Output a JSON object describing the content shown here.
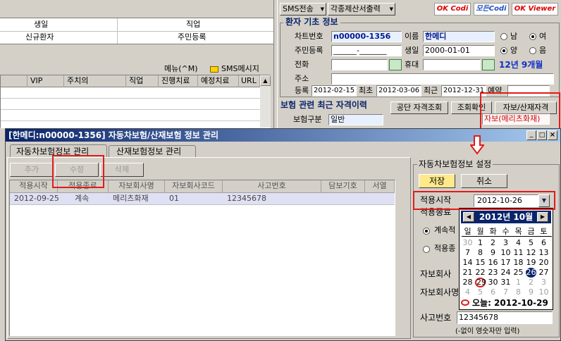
{
  "left_top": {
    "row1": {
      "c1": "생일",
      "c2": "직업"
    },
    "row2": {
      "c1": "신규환자",
      "c2": "주민등록"
    }
  },
  "left_grid": {
    "menu_label": "메뉴(^M)",
    "sms_label": "SMS메시지",
    "columns": [
      "VIP",
      "주치의",
      "직업",
      "진행치료",
      "예정치료",
      "URL"
    ]
  },
  "top_toolbar": {
    "sms_send": "SMS전송",
    "forms_print": "각종제산서출력",
    "logo1": "OK Codi",
    "logo2": "모든Codi",
    "logo3": "OK Viewer"
  },
  "patient": {
    "section_title": "환자 기초 정보",
    "chart_no_label": "차트번호",
    "chart_no": "n00000-1356",
    "name_label": "이름",
    "name": "한메디",
    "gender_male": "남",
    "gender_female": "여",
    "rrn_label": "주민등록",
    "rrn": "______-_______",
    "birth_label": "생일",
    "birth": "2000-01-01",
    "cal_solar": "양",
    "cal_lunar": "음",
    "phone_label": "전화",
    "mobile_label": "휴대",
    "age": "12년 9개월",
    "address_label": "주소",
    "reg_label": "등록",
    "reg_date": "2012-02-15",
    "first_label": "최초",
    "first_date": "2012-03-06",
    "last_label": "최근",
    "last_date": "2012-12-31",
    "extra_label": "예약"
  },
  "insurance": {
    "section_title": "보험 관련 최근 자격이력",
    "btn_check": "공단 자격조회",
    "btn_verify": "조회확인",
    "btn_auto": "자보/산재자격",
    "type_label": "보험구분",
    "type_value": "일반",
    "auto_value": "자보(메리츠화재)"
  },
  "dialog": {
    "title": "[한메디:n00000-1356] 자동차보험/산재보험 정보 관리",
    "tab_auto": "자동차보험정보 관리",
    "tab_industrial": "산재보험정보 관리",
    "btn_add": "추가",
    "btn_edit": "수정",
    "btn_delete": "삭제",
    "columns": [
      "적용시작",
      "적용종료",
      "자보회사명",
      "자보회사코드",
      "사고번호",
      "담보기호",
      "서열"
    ],
    "rows": [
      [
        "2012-09-25",
        "계속",
        "메리츠화재",
        "01",
        "12345678",
        "",
        ""
      ]
    ]
  },
  "settings": {
    "group_title": "자동차보험정보 설정",
    "btn_save": "저장",
    "btn_cancel": "취소",
    "start_label": "적용시작",
    "start_value": "2012-10-26",
    "end_label": "적용종료",
    "opt_continue": "계속적",
    "opt_end": "적용종",
    "company_label": "자보회사",
    "company_code_label": "자보회사명",
    "accident_label": "사고번호",
    "accident_value": "12345678",
    "hint": "(-없이 영숫자만 입력)"
  },
  "calendar": {
    "month_label": "2012년 10월",
    "weekdays": [
      "일",
      "월",
      "화",
      "수",
      "목",
      "금",
      "토"
    ],
    "weeks": [
      [
        "30",
        "1",
        "2",
        "3",
        "4",
        "5",
        "6"
      ],
      [
        "7",
        "8",
        "9",
        "10",
        "11",
        "12",
        "13"
      ],
      [
        "14",
        "15",
        "16",
        "17",
        "18",
        "19",
        "20"
      ],
      [
        "21",
        "22",
        "23",
        "24",
        "25",
        "26",
        "27"
      ],
      [
        "28",
        "29",
        "30",
        "31",
        "1",
        "2",
        "3"
      ],
      [
        "4",
        "5",
        "6",
        "7",
        "8",
        "9",
        "10"
      ]
    ],
    "today_text": "오늘: 2012-10-29"
  },
  "colors": {
    "accent_red": "#e01b1b",
    "title_blue": "#0a246a",
    "age_blue": "#1030c0"
  }
}
